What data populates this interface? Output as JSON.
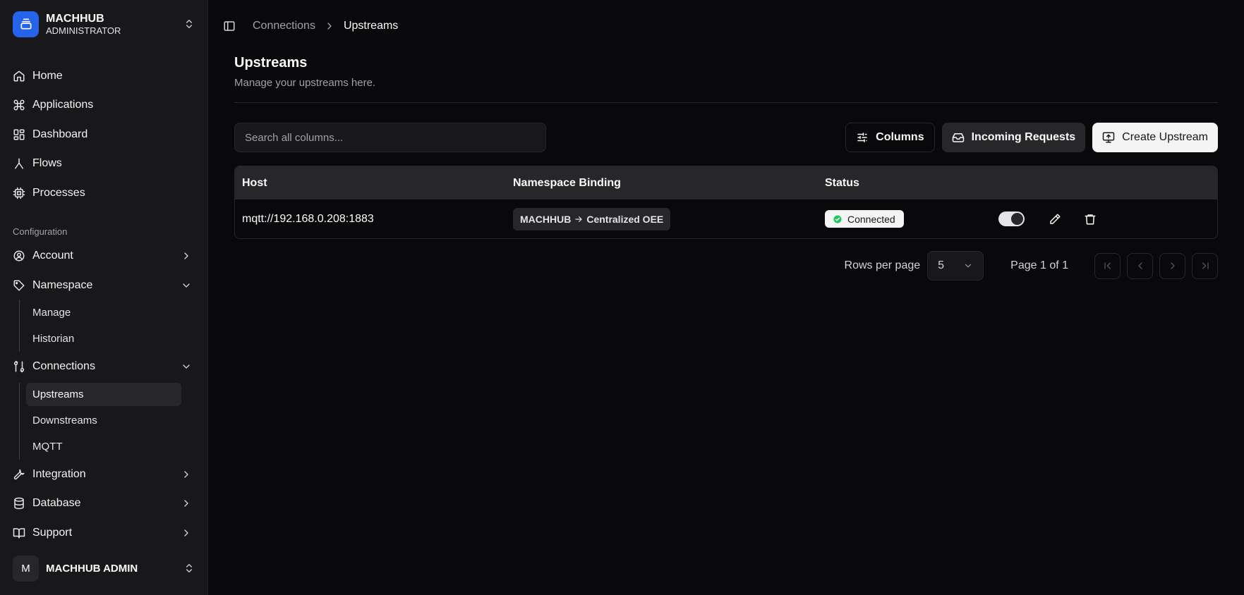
{
  "brand": {
    "name": "MACHHUB",
    "role": "ADMINISTRATOR"
  },
  "nav": {
    "home": "Home",
    "applications": "Applications",
    "dashboard": "Dashboard",
    "flows": "Flows",
    "processes": "Processes",
    "group_label": "Configuration",
    "account": "Account",
    "namespace": "Namespace",
    "namespace_sub": [
      "Manage",
      "Historian"
    ],
    "connections": "Connections",
    "connections_sub": [
      "Upstreams",
      "Downstreams",
      "MQTT"
    ],
    "integration": "Integration",
    "database": "Database",
    "support": "Support"
  },
  "user": {
    "initial": "M",
    "name": "MACHHUB ADMIN"
  },
  "breadcrumb": {
    "parent": "Connections",
    "current": "Upstreams"
  },
  "page": {
    "title": "Upstreams",
    "subtitle": "Manage your upstreams here."
  },
  "toolbar": {
    "search_placeholder": "Search all columns...",
    "columns_label": "Columns",
    "incoming_label": "Incoming Requests",
    "create_label": "Create Upstream"
  },
  "table": {
    "headers": {
      "host": "Host",
      "namespace": "Namespace Binding",
      "status": "Status"
    },
    "rows": [
      {
        "host": "mqtt://192.168.0.208:1883",
        "ns_from": "MACHHUB",
        "ns_to": "Centralized OEE",
        "status": "Connected",
        "enabled": true
      }
    ]
  },
  "pagination": {
    "rows_label": "Rows per page",
    "rows_value": "5",
    "page_info": "Page 1 of 1"
  },
  "colors": {
    "accent": "#2563eb",
    "status_ok": "#22c55e",
    "background": "#09090b",
    "sidebar": "#18181b"
  }
}
